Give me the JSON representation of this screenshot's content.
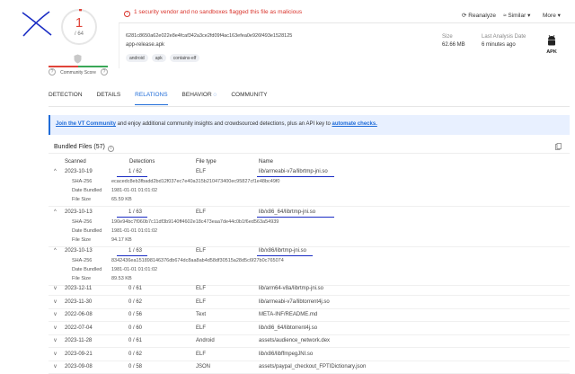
{
  "score": {
    "detected": "1",
    "total": "/ 64"
  },
  "community": {
    "label": "Community Score",
    "left_icon": "question-icon",
    "right_icon": "question-icon"
  },
  "alert": {
    "text": "1 security vendor and no sandboxes flagged this file as malicious"
  },
  "actions": {
    "reanalyze": "Reanalyze",
    "similar": "Similar",
    "more": "More"
  },
  "file": {
    "hash": "6281c8650a62e022e8e4fcaf342a3ce2fd09f4ac163efea0e926f493e1528125",
    "name": "app-release.apk",
    "tags": [
      "android",
      "apk",
      "contains-elf"
    ],
    "size_label": "Size",
    "size_value": "62.66 MB",
    "analysis_label": "Last Analysis Date",
    "analysis_value": "6 minutes ago",
    "type_label": "APK"
  },
  "tabs": [
    "DETECTION",
    "DETAILS",
    "RELATIONS",
    "BEHAVIOR",
    "COMMUNITY"
  ],
  "banner": {
    "link1": "Join the VT Community",
    "text": " and enjoy additional community insights and crowdsourced detections, plus an API key to ",
    "link2": "automate checks."
  },
  "bundled": {
    "title": "Bundled Files",
    "count": "(57)",
    "headers": {
      "scanned": "Scanned",
      "detections": "Detections",
      "file_type": "File type",
      "name": "Name"
    },
    "expanded": [
      {
        "date": "2023-10-19",
        "det": "1 / 62",
        "type": "ELF",
        "name": "lib/armeabi-v7a/librtmp-jni.so",
        "sha_label": "SHA-256",
        "sha": "ecacedc8eb3fbadd2bd12f037ec7e40a315b210473400ec95827cf1e48bc49f0",
        "date_label": "Date Bundled",
        "bundled": "1981-01-01 01:01:02",
        "size_label": "File Size",
        "size": "65.59 KB"
      },
      {
        "date": "2023-10-13",
        "det": "1 / 63",
        "type": "ELF",
        "name": "lib/x86_64/librtmp-jni.so",
        "sha_label": "SHA-256",
        "sha": "190e94bc7f060b7c11df3b9140ff4602e18c473eaa7de44c0b1f6ed563a54939",
        "date_label": "Date Bundled",
        "bundled": "1981-01-01 01:01:02",
        "size_label": "File Size",
        "size": "94.17 KB"
      },
      {
        "date": "2023-10-13",
        "det": "1 / 63",
        "type": "ELF",
        "name": "lib/x86/librtmp-jni.so",
        "sha_label": "SHA-256",
        "sha": "8342436ea151898146376db674dc8aa8ab4d58df30515a28d5c6f27b0c765074",
        "date_label": "Date Bundled",
        "bundled": "1981-01-01 01:01:02",
        "size_label": "File Size",
        "size": "89.53 KB"
      }
    ],
    "collapsed": [
      {
        "date": "2023-12-11",
        "det": "0 / 61",
        "type": "ELF",
        "name": "lib/arm64-v8a/librtmp-jni.so"
      },
      {
        "date": "2023-11-30",
        "det": "0 / 62",
        "type": "ELF",
        "name": "lib/armeabi-v7a/libtorrent4j.so"
      },
      {
        "date": "2022-06-08",
        "det": "0 / 56",
        "type": "Text",
        "name": "META-INF/README.md"
      },
      {
        "date": "2022-07-04",
        "det": "0 / 60",
        "type": "ELF",
        "name": "lib/x86_64/libtorrent4j.so"
      },
      {
        "date": "2023-11-28",
        "det": "0 / 61",
        "type": "Android",
        "name": "assets/audience_network.dex"
      },
      {
        "date": "2023-09-21",
        "det": "0 / 62",
        "type": "ELF",
        "name": "lib/x86/libffmpegJNI.so"
      },
      {
        "date": "2023-09-08",
        "det": "0 / 58",
        "type": "JSON",
        "name": "assets/paypal_checkout_FPTIDictionary.json"
      }
    ]
  },
  "colors": {
    "malicious": "#e0443a",
    "accent": "#1f6cd8",
    "annotation": "#1a2cc4"
  }
}
